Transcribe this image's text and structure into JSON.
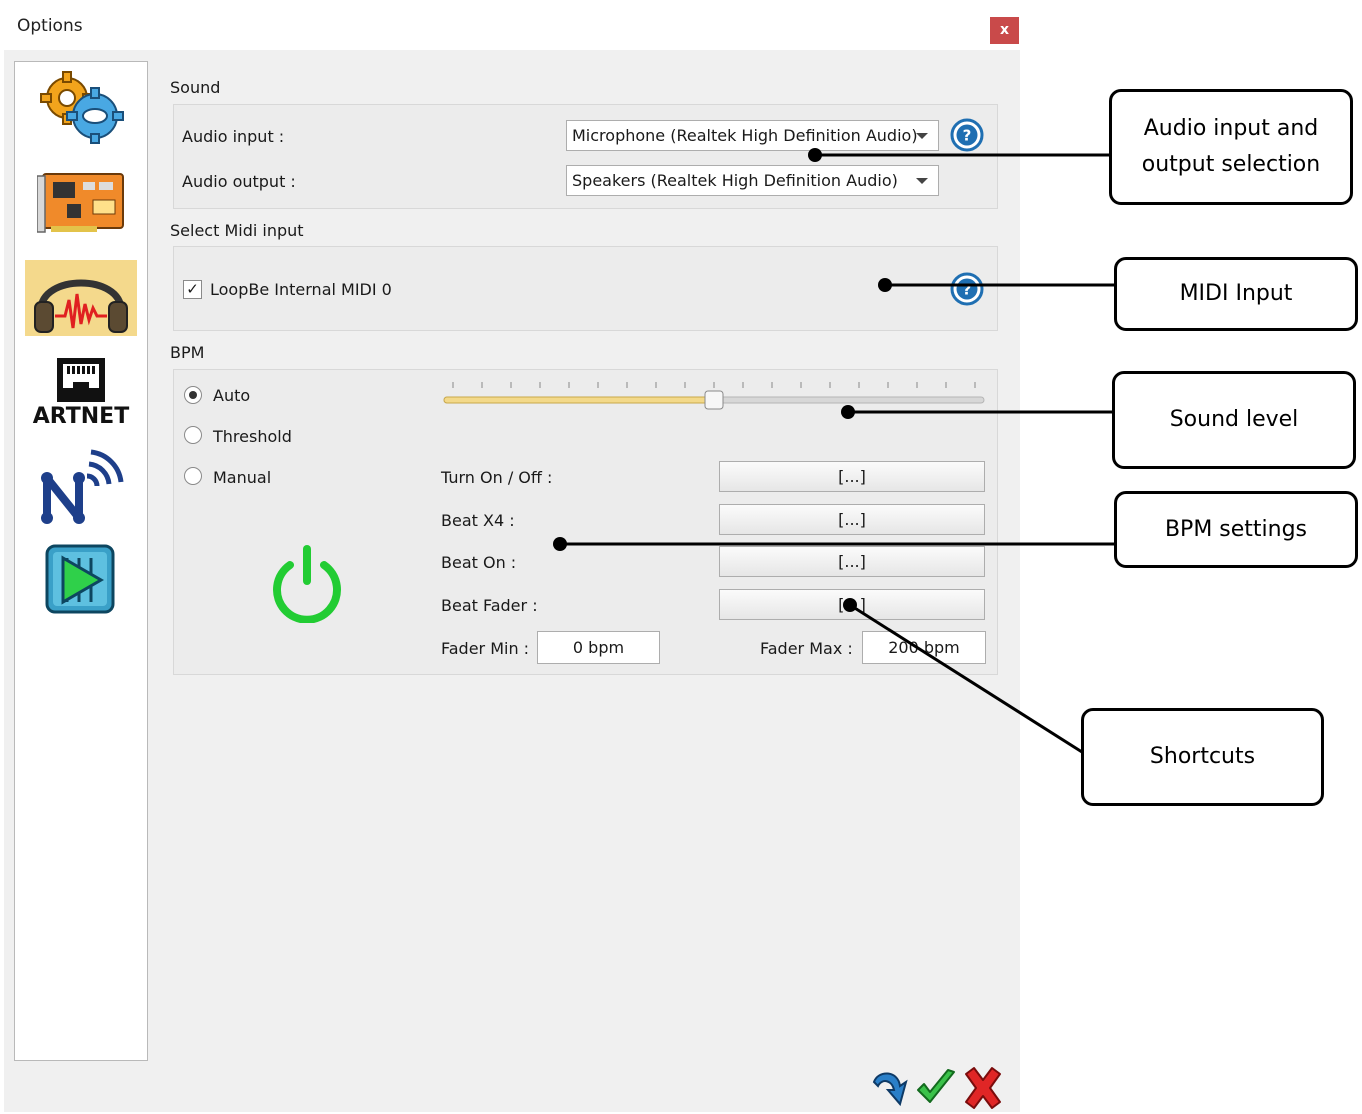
{
  "window": {
    "title": "Options",
    "close_label": "x"
  },
  "sidebar": {
    "items": [
      {
        "icon": "gears-icon"
      },
      {
        "icon": "circuit-board-icon"
      },
      {
        "icon": "headphones-audio-icon",
        "selected": true
      },
      {
        "icon": "artnet-icon",
        "label": "ARTNET"
      },
      {
        "icon": "network-signal-icon"
      },
      {
        "icon": "play-sequence-icon"
      }
    ]
  },
  "sound": {
    "heading": "Sound",
    "audio_input_label": "Audio input :",
    "audio_input_value": "Microphone (Realtek High Definition Audio)",
    "audio_output_label": "Audio output :",
    "audio_output_value": "Speakers (Realtek High Definition Audio)"
  },
  "midi": {
    "heading": "Select Midi input",
    "device_label": "LoopBe Internal MIDI 0",
    "device_checked": true
  },
  "bpm": {
    "heading": "BPM",
    "modes": [
      {
        "label": "Auto",
        "selected": true
      },
      {
        "label": "Threshold",
        "selected": false
      },
      {
        "label": "Manual",
        "selected": false
      }
    ],
    "sound_level": 0.5,
    "shortcuts": [
      {
        "label": "Turn On / Off :",
        "value": "[...]"
      },
      {
        "label": "Beat X4 :",
        "value": "[...]"
      },
      {
        "label": "Beat On :",
        "value": "[...]"
      },
      {
        "label": "Beat Fader :",
        "value": "[...]"
      }
    ],
    "fader_min_label": "Fader Min :",
    "fader_min_value": "0   bpm",
    "fader_max_label": "Fader Max :",
    "fader_max_value": "200 bpm"
  },
  "footer": {
    "icons": [
      "redo-arrow-icon",
      "check-icon",
      "cancel-x-icon"
    ]
  },
  "callouts": {
    "audio_io": "Audio input and output selection",
    "midi_input": "MIDI Input",
    "sound_level": "Sound level",
    "bpm_settings": "BPM settings",
    "shortcuts": "Shortcuts"
  },
  "colors": {
    "accent_blue": "#1f6fb2",
    "power_green": "#22cc33",
    "slider_fill": "#f3d98a",
    "close_red": "#c94a4a"
  }
}
